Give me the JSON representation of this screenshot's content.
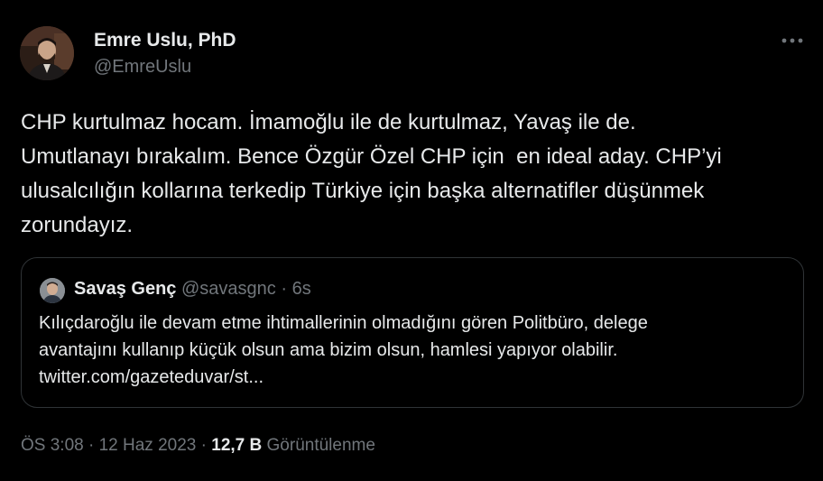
{
  "author": {
    "name": "Emre Uslu, PhD",
    "handle": "@EmreUslu",
    "avatar_icon": "profile-photo"
  },
  "more_icon": "more-dots-icon",
  "tweet": {
    "lines": [
      "CHP kurtulmaz hocam. İmamoğlu ile de kurtulmaz, Yavaş ile de.",
      "Umutlanayı bırakalım. Bence Özgür Özel CHP için  en ideal aday. CHP’yi",
      "ulusalcılığın kollarına terkedip Türkiye için başka alternatifler düşünmek",
      "zorundayız."
    ]
  },
  "quoted": {
    "name": "Savaş Genç",
    "handle": "@savasgnc",
    "separator": "·",
    "time": "6s",
    "lines": [
      "Kılıçdaroğlu ile devam etme ihtimallerinin olmadığını gören Politbüro, delege",
      "avantajını kullanıp küçük olsun ama bizim olsun, hamlesi yapıyor olabilir.",
      "twitter.com/gazeteduvar/st..."
    ]
  },
  "meta": {
    "time": "ÖS 3:08",
    "sep1": "·",
    "date": "12 Haz 2023",
    "sep2": "·",
    "views_count": "12,7 B",
    "views_label": "Görüntülenme"
  },
  "colors": {
    "background": "#000000",
    "primary_text": "#e7e9ea",
    "secondary_text": "#71767b",
    "border": "#2f3336"
  }
}
